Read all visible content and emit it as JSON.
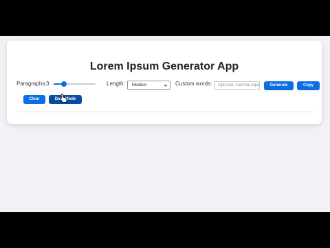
{
  "app": {
    "title": "Lorem Ipsum Generator App"
  },
  "controls": {
    "paragraphs_label": "Paragraphs:",
    "paragraphs_value": "3",
    "paragraphs_slider_fraction": 0.25,
    "length_label": "Length:",
    "length_selected": "Medium",
    "custom_words_label": "Custom words:",
    "custom_words_value": "",
    "custom_words_placeholder": "Optional, comma-separated"
  },
  "buttons": {
    "generate": "Generate",
    "copy": "Copy",
    "clear": "Clear",
    "dark_mode": "Dark Mode"
  },
  "colors": {
    "accent": "#0b6ee4",
    "accent_dark": "#0a4c9e",
    "page_background": "#f1f2f6",
    "card_background": "#ffffff"
  },
  "icons": {
    "select_chevron": "chevron-down-icon",
    "cursor": "hand-pointer-icon"
  }
}
